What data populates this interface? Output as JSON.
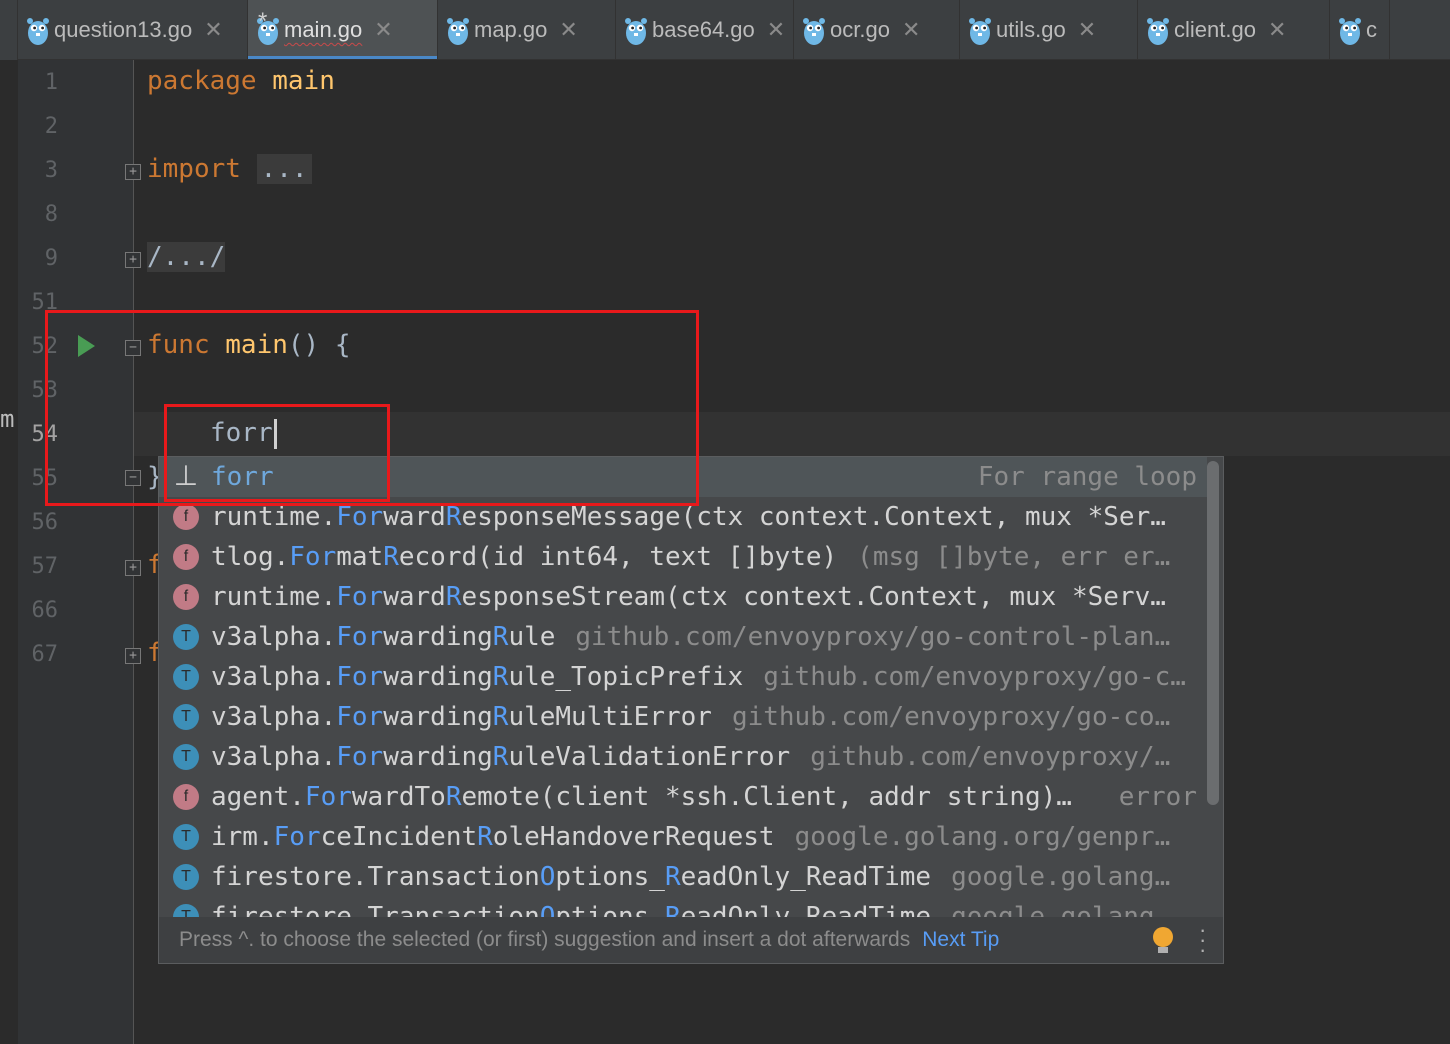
{
  "tabs": [
    {
      "name": "question13.go",
      "active": false,
      "modified": false
    },
    {
      "name": "main.go",
      "active": true,
      "modified": true
    },
    {
      "name": "map.go",
      "active": false,
      "modified": false
    },
    {
      "name": "base64.go",
      "active": false,
      "modified": false
    },
    {
      "name": "ocr.go",
      "active": false,
      "modified": false
    },
    {
      "name": "utils.go",
      "active": false,
      "modified": false
    },
    {
      "name": "client.go",
      "active": false,
      "modified": false
    },
    {
      "name": "c",
      "active": false,
      "modified": false
    }
  ],
  "tab_modified_marker": "*",
  "tab_close_glyph": "✕",
  "left_stub": "m",
  "line_numbers": [
    "1",
    "2",
    "3",
    "8",
    "9",
    "51",
    "52",
    "53",
    "54",
    "55",
    "56",
    "57",
    "66",
    "67"
  ],
  "code": {
    "line1_kw": "package",
    "line1_name": "main",
    "line3_kw": "import",
    "line3_fold": "...",
    "line9_fold": "/.../",
    "line52_kw": "func",
    "line52_fn": "main",
    "line52_rest": "() {",
    "line54_typed": "forr",
    "line55_brace": "}",
    "line57_char": "f",
    "line67_char": "f"
  },
  "completion": {
    "items": [
      {
        "icon": "live-template-icon",
        "icon_glyph": "⊥",
        "pre": "",
        "h1": "forr",
        "mid": "",
        "h2": "",
        "post": "",
        "extra": "For range loop",
        "extra_align": "right"
      },
      {
        "icon": "function-icon",
        "icon_glyph": "f",
        "pre": "runtime.",
        "h1": "For",
        "mid": "ward",
        "h2": "R",
        "post": "esponseMessage(ctx context.Context, mux *Ser…",
        "extra": "",
        "extra_align": "left"
      },
      {
        "icon": "function-icon",
        "icon_glyph": "f",
        "pre": "tlog.",
        "h1": "For",
        "mid": "mat",
        "h2": "R",
        "post": "ecord(id int64, text []byte)",
        "extra": "(msg []byte, err er…",
        "extra_align": "left"
      },
      {
        "icon": "function-icon",
        "icon_glyph": "f",
        "pre": "runtime.",
        "h1": "For",
        "mid": "ward",
        "h2": "R",
        "post": "esponseStream(ctx context.Context, mux *Serv…",
        "extra": "",
        "extra_align": "left"
      },
      {
        "icon": "type-icon",
        "icon_glyph": "T",
        "pre": "v3alpha.",
        "h1": "For",
        "mid": "warding",
        "h2": "R",
        "post": "ule",
        "extra": "github.com/envoyproxy/go-control-plan…",
        "extra_align": "left"
      },
      {
        "icon": "type-icon",
        "icon_glyph": "T",
        "pre": "v3alpha.",
        "h1": "For",
        "mid": "warding",
        "h2": "R",
        "post": "ule_TopicPrefix",
        "extra": "github.com/envoyproxy/go-c…",
        "extra_align": "left"
      },
      {
        "icon": "type-icon",
        "icon_glyph": "T",
        "pre": "v3alpha.",
        "h1": "For",
        "mid": "warding",
        "h2": "R",
        "post": "uleMultiError",
        "extra": "github.com/envoyproxy/go-co…",
        "extra_align": "left"
      },
      {
        "icon": "type-icon",
        "icon_glyph": "T",
        "pre": "v3alpha.",
        "h1": "For",
        "mid": "warding",
        "h2": "R",
        "post": "uleValidationError",
        "extra": "github.com/envoyproxy/…",
        "extra_align": "left"
      },
      {
        "icon": "function-icon",
        "icon_glyph": "f",
        "pre": "agent.",
        "h1": "For",
        "mid": "wardTo",
        "h2": "R",
        "post": "emote(client *ssh.Client, addr string)…",
        "extra": "error",
        "extra_align": "right"
      },
      {
        "icon": "type-icon",
        "icon_glyph": "T",
        "pre": "irm.",
        "h1": "For",
        "mid": "ceIncident",
        "h2": "R",
        "post": "oleHandoverRequest",
        "extra": "google.golang.org/genpr…",
        "extra_align": "left"
      },
      {
        "icon": "type-icon",
        "icon_glyph": "T",
        "pre": "firestore.Transaction",
        "h1": "O",
        "mid": "ptions_",
        "h2": "R",
        "post": "eadOnly_ReadTime",
        "extra": "google.golang…",
        "extra_align": "left"
      },
      {
        "icon": "type-icon",
        "icon_glyph": "T",
        "pre": "firestore.Transaction",
        "h1": "O",
        "mid": "ptions_",
        "h2": "R",
        "post": "eadOnly_ReadTime",
        "extra": "google.golang…",
        "extra_align": "left"
      }
    ],
    "footer_text": "Press ^. to choose the selected (or first) suggestion and insert a dot afterwards",
    "footer_link": "Next Tip"
  },
  "colors": {
    "accent": "#4a88c7",
    "annotation_red": "#e8191b",
    "keyword": "#cc7832",
    "function": "#ffc66d",
    "match_highlight": "#589df6"
  }
}
